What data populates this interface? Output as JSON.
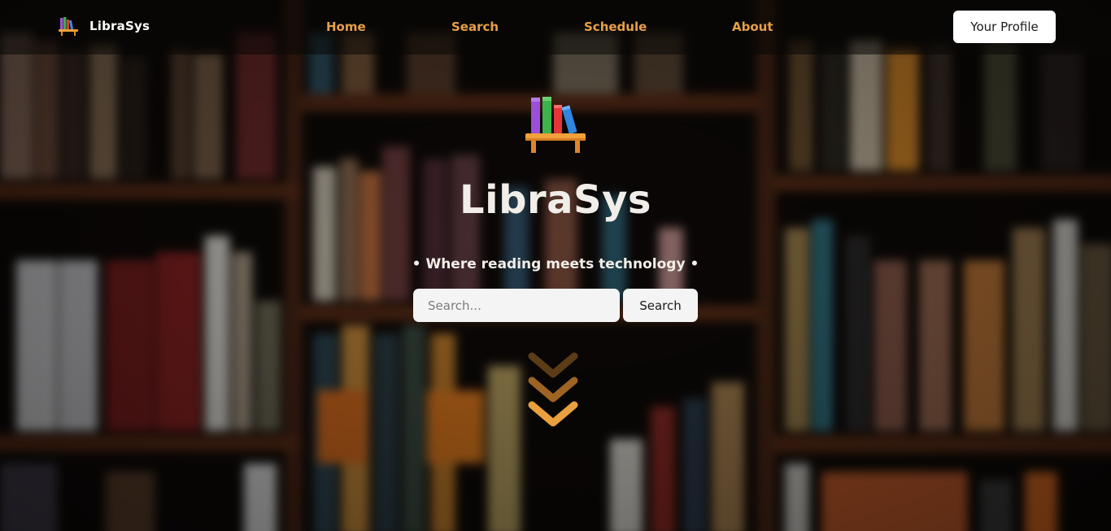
{
  "app": {
    "name": "LibraSys",
    "logo_icon": "bookshelf-icon"
  },
  "nav": {
    "links": [
      {
        "label": "Home"
      },
      {
        "label": "Search"
      },
      {
        "label": "Schedule"
      },
      {
        "label": "About"
      }
    ],
    "profile_label": "Your Profile"
  },
  "hero": {
    "title": "LibraSys",
    "tagline": "• Where reading meets technology •",
    "logo_icon": "bookshelf-icon",
    "scroll_icon": "chevrons-down-icon"
  },
  "search": {
    "placeholder": "Search...",
    "value": "",
    "button_label": "Search"
  },
  "colors": {
    "accent": "#e7a046",
    "nav_background": "rgba(10,8,6,0.55)",
    "button_background": "#ffffff",
    "title_text": "#f1eee9"
  }
}
